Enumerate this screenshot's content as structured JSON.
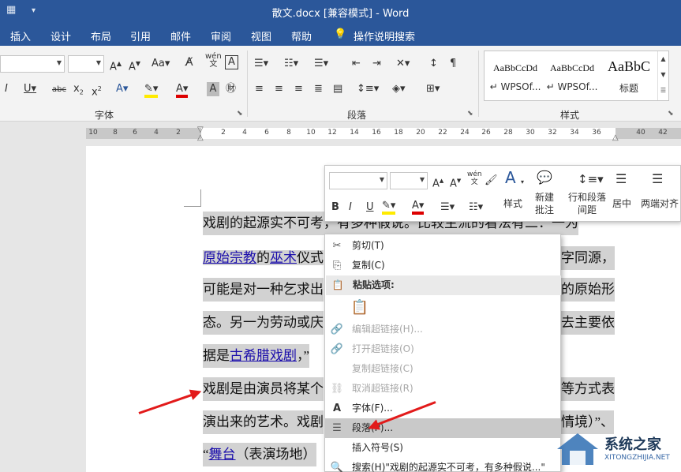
{
  "titlebar": {
    "title": "散文.docx [兼容模式]  -  Word"
  },
  "tabs": [
    "插入",
    "设计",
    "布局",
    "引用",
    "邮件",
    "审阅",
    "视图",
    "帮助",
    "操作说明搜索"
  ],
  "ribbon": {
    "font_group_label": "字体",
    "paragraph_group_label": "段落",
    "styles_group_label": "样式",
    "styles": [
      {
        "preview": "AaBbCcDd",
        "name": "↵ WPSOf..."
      },
      {
        "preview": "AaBbCcDd",
        "name": "↵ WPSOf..."
      },
      {
        "preview": "AaBbC",
        "name": "标题"
      }
    ]
  },
  "ruler": {
    "ticks": [
      "10",
      "8",
      "6",
      "4",
      "2",
      "",
      "2",
      "4",
      "6",
      "8",
      "10",
      "12",
      "14",
      "16",
      "18",
      "20",
      "22",
      "24",
      "26",
      "28",
      "30",
      "32",
      "34",
      "36",
      "",
      "40",
      "42"
    ]
  },
  "document": {
    "line1": "戏剧的起源实不可考，有多种假说。比较主流的看法有二：一为",
    "line2_pre": "",
    "line2_link1": "原始宗教",
    "line2_mid": "的",
    "line2_link2": "巫术",
    "line2_post": "仪式",
    "line2_right": "字同源，",
    "line3_left": "可能是对一种乞求出",
    "line3_right": "的原始形",
    "line4_left": "态。另一为劳动或庆",
    "line4_right": "去主要依",
    "line5_pre": "据是",
    "line5_link": "古希腊戏剧",
    "line5_post": "，”",
    "line6_left": "戏剧是由演员将某个",
    "line6_right": "等方式表",
    "line7_left": "演出来的艺术。戏剧",
    "line7_right": "情境）”、",
    "line8_pre": "“",
    "line8_link": "舞台",
    "line8_post": "（表演场地）"
  },
  "mini_toolbar": {
    "styles_label": "样式",
    "new_comment_label": "新建批注",
    "line_spacing_label": "行和段落间距",
    "center_label": "居中",
    "justify_label": "两端对齐",
    "wen_label": "wén 文"
  },
  "context_menu": {
    "items": [
      {
        "icon": "scissors-icon",
        "label": "剪切(T)",
        "disabled": false
      },
      {
        "icon": "copy-icon",
        "label": "复制(C)",
        "disabled": false
      },
      {
        "icon": "paste-icon",
        "label": "粘贴选项:",
        "header": true
      },
      {
        "icon": "paste-text-only-icon",
        "label": "",
        "paste_option": true
      },
      {
        "icon": "link-edit-icon",
        "label": "编辑超链接(H)...",
        "disabled": true
      },
      {
        "icon": "link-open-icon",
        "label": "打开超链接(O)",
        "disabled": true
      },
      {
        "icon": "",
        "label": "复制超链接(C)",
        "disabled": true
      },
      {
        "icon": "link-remove-icon",
        "label": "取消超链接(R)",
        "disabled": true
      },
      {
        "icon": "font-icon",
        "label": "字体(F)...",
        "disabled": false
      },
      {
        "icon": "paragraph-icon",
        "label": "段落(P)...",
        "disabled": false,
        "highlighted": true
      },
      {
        "icon": "",
        "label": "插入符号(S)",
        "disabled": false
      },
      {
        "icon": "search-icon",
        "label": "搜索(H)\"戏剧的起源实不可考，有多种假说...\"",
        "disabled": false
      }
    ]
  },
  "watermark": {
    "name": "系统之家",
    "url": "XITONGZHIJIA.NET"
  },
  "colors": {
    "brand": "#2b579a",
    "annotation_arrow": "#e21a1a",
    "selection": "#d2d2d2"
  }
}
